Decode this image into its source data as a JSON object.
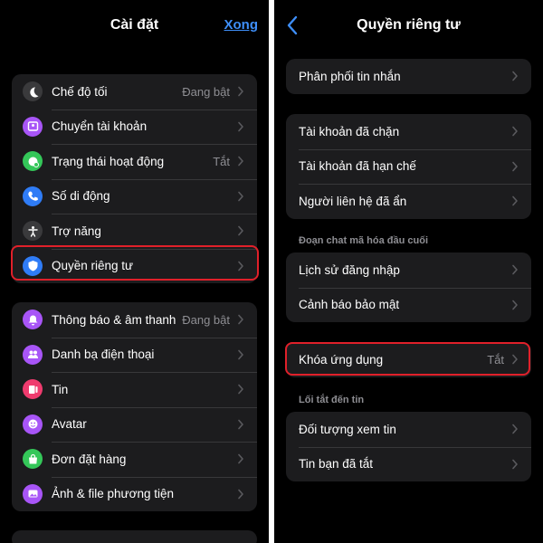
{
  "left_panel": {
    "title": "Cài đặt",
    "done_label": "Xong",
    "group1": [
      {
        "label": "Chế độ tối",
        "value": "Đang bật",
        "icon": "moon-icon",
        "color": "#3a3a3c"
      },
      {
        "label": "Chuyển tài khoản",
        "value": "",
        "icon": "switch-account-icon",
        "color": "#a855f7"
      },
      {
        "label": "Trạng thái hoạt động",
        "value": "Tắt",
        "icon": "active-status-icon",
        "color": "#34c759"
      },
      {
        "label": "Số di động",
        "value": "",
        "icon": "phone-icon",
        "color": "#2f7cf6"
      },
      {
        "label": "Trợ năng",
        "value": "",
        "icon": "accessibility-icon",
        "color": "#3a3a3c"
      },
      {
        "label": "Quyền riêng tư",
        "value": "",
        "icon": "shield-icon",
        "color": "#2f7cf6"
      }
    ],
    "group2": [
      {
        "label": "Thông báo & âm thanh",
        "value": "Đang bật",
        "icon": "bell-icon",
        "color": "#a855f7"
      },
      {
        "label": "Danh bạ điện thoại",
        "value": "",
        "icon": "contacts-icon",
        "color": "#a855f7"
      },
      {
        "label": "Tin",
        "value": "",
        "icon": "story-icon",
        "color": "#ef3b6e"
      },
      {
        "label": "Avatar",
        "value": "",
        "icon": "avatar-icon",
        "color": "#a855f7"
      },
      {
        "label": "Đơn đặt hàng",
        "value": "",
        "icon": "shopping-bag-icon",
        "color": "#34c759"
      },
      {
        "label": "Ảnh & file phương tiện",
        "value": "",
        "icon": "photo-icon",
        "color": "#a855f7"
      }
    ]
  },
  "right_panel": {
    "title": "Quyền riêng tư",
    "group1": [
      {
        "label": "Phân phối tin nhắn",
        "value": ""
      }
    ],
    "group2": [
      {
        "label": "Tài khoản đã chặn",
        "value": ""
      },
      {
        "label": "Tài khoản đã hạn chế",
        "value": ""
      },
      {
        "label": "Người liên hệ đã ẩn",
        "value": ""
      }
    ],
    "section_e2ee": "Đoạn chat mã hóa đầu cuối",
    "group3": [
      {
        "label": "Lịch sử đăng nhập",
        "value": ""
      },
      {
        "label": "Cảnh báo bảo mật",
        "value": ""
      }
    ],
    "group4": [
      {
        "label": "Khóa ứng dụng",
        "value": "Tắt"
      }
    ],
    "section_shortcuts": "Lối tắt đến tin",
    "group5": [
      {
        "label": "Đối tượng xem tin",
        "value": ""
      },
      {
        "label": "Tin bạn đã tắt",
        "value": ""
      }
    ]
  },
  "colors": {
    "accent": "#3e8ef7",
    "highlight": "#e0202a",
    "cell_bg": "#1c1c1e"
  }
}
